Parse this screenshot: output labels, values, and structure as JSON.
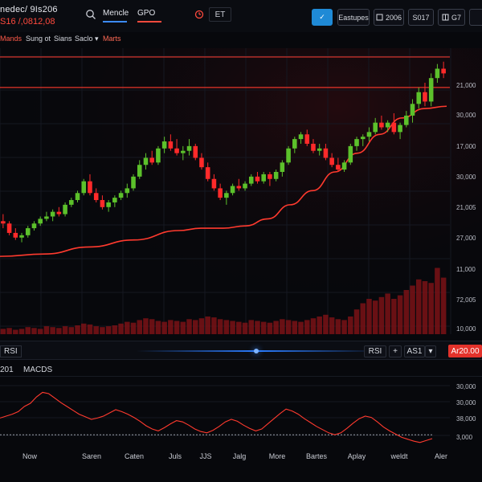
{
  "topbar": {
    "title": "nedec/ 9Is206",
    "price": "S16 /,0812,08",
    "tabs": [
      {
        "label": "Mencle",
        "accent": "#3c8bff"
      },
      {
        "label": "GPO",
        "accent": "#ff4a3d"
      }
    ],
    "et_label": "ET",
    "check_symbol": "✓",
    "buttons": [
      "Eastupes",
      "2006",
      "S017",
      "G7"
    ]
  },
  "menu": {
    "items": [
      {
        "label": "Mands",
        "color": "#ff5a4a"
      },
      {
        "label": "Sung ot",
        "color": "#d5d8df"
      },
      {
        "label": "Sians",
        "color": "#d5d8df"
      },
      {
        "label": "Saclo ▾",
        "color": "#d5d8df"
      },
      {
        "label": "Marts",
        "color": "#ff6a55"
      }
    ]
  },
  "main_axis": {
    "labels": [
      "21,000",
      "30,000",
      "17,000",
      "30,000",
      "21,005",
      "27,000",
      "11,000",
      "72,005",
      "10,000"
    ]
  },
  "chart_data": [
    {
      "type": "candlestick",
      "candles_ohlc": [
        [
          29,
          32,
          26,
          28
        ],
        [
          28,
          29,
          23,
          24
        ],
        [
          24,
          26,
          21,
          22
        ],
        [
          22,
          24,
          20,
          23
        ],
        [
          23,
          27,
          22,
          26
        ],
        [
          26,
          29,
          25,
          28
        ],
        [
          28,
          31,
          27,
          30
        ],
        [
          30,
          33,
          29,
          31
        ],
        [
          31,
          34,
          29,
          33
        ],
        [
          33,
          35,
          31,
          32
        ],
        [
          32,
          37,
          31,
          36
        ],
        [
          36,
          39,
          35,
          38
        ],
        [
          38,
          42,
          37,
          41
        ],
        [
          41,
          47,
          40,
          46
        ],
        [
          46,
          49,
          40,
          41
        ],
        [
          41,
          43,
          37,
          38
        ],
        [
          38,
          40,
          34,
          35
        ],
        [
          35,
          38,
          33,
          37
        ],
        [
          37,
          40,
          35,
          39
        ],
        [
          39,
          42,
          38,
          41
        ],
        [
          41,
          45,
          39,
          43
        ],
        [
          43,
          49,
          42,
          48
        ],
        [
          48,
          55,
          47,
          53
        ],
        [
          53,
          58,
          51,
          56
        ],
        [
          56,
          59,
          53,
          54
        ],
        [
          54,
          61,
          53,
          60
        ],
        [
          60,
          65,
          58,
          63
        ],
        [
          63,
          66,
          59,
          60
        ],
        [
          60,
          64,
          57,
          58
        ],
        [
          58,
          61,
          55,
          59
        ],
        [
          59,
          64,
          57,
          61
        ],
        [
          61,
          62,
          55,
          56
        ],
        [
          56,
          58,
          51,
          52
        ],
        [
          52,
          54,
          46,
          47
        ],
        [
          47,
          49,
          42,
          43
        ],
        [
          43,
          45,
          38,
          39
        ],
        [
          39,
          42,
          36,
          41
        ],
        [
          41,
          45,
          40,
          44
        ],
        [
          44,
          47,
          42,
          43
        ],
        [
          43,
          46,
          42,
          45
        ],
        [
          45,
          49,
          44,
          48
        ],
        [
          48,
          50,
          45,
          46
        ],
        [
          46,
          50,
          45,
          49
        ],
        [
          49,
          50,
          44,
          47
        ],
        [
          47,
          51,
          46,
          50
        ],
        [
          50,
          55,
          48,
          54
        ],
        [
          54,
          61,
          53,
          60
        ],
        [
          60,
          65,
          58,
          64
        ],
        [
          64,
          67,
          62,
          66
        ],
        [
          66,
          68,
          61,
          62
        ],
        [
          62,
          64,
          58,
          59
        ],
        [
          59,
          62,
          57,
          60
        ],
        [
          60,
          62,
          55,
          56
        ],
        [
          56,
          58,
          52,
          53
        ],
        [
          53,
          56,
          50,
          51
        ],
        [
          51,
          55,
          50,
          54
        ],
        [
          54,
          62,
          53,
          61
        ],
        [
          61,
          65,
          59,
          64
        ],
        [
          64,
          66,
          61,
          65
        ],
        [
          65,
          69,
          63,
          67
        ],
        [
          67,
          73,
          66,
          71
        ],
        [
          71,
          74,
          68,
          69
        ],
        [
          69,
          72,
          67,
          71
        ],
        [
          71,
          75,
          66,
          67
        ],
        [
          67,
          71,
          64,
          70
        ],
        [
          70,
          76,
          69,
          74
        ],
        [
          74,
          81,
          71,
          79
        ],
        [
          79,
          86,
          77,
          84
        ],
        [
          84,
          88,
          78,
          80
        ],
        [
          80,
          92,
          78,
          90
        ],
        [
          90,
          96,
          88,
          94
        ],
        [
          94,
          97,
          90,
          92
        ]
      ],
      "moving_average": [
        [
          0,
          14
        ],
        [
          10,
          15
        ],
        [
          20,
          18
        ],
        [
          30,
          21
        ],
        [
          40,
          25
        ],
        [
          45,
          26
        ],
        [
          50,
          26
        ],
        [
          55,
          27
        ],
        [
          60,
          30
        ],
        [
          65,
          36
        ],
        [
          70,
          42
        ],
        [
          75,
          50
        ],
        [
          80,
          58
        ],
        [
          85,
          66
        ],
        [
          90,
          73
        ],
        [
          95,
          77
        ],
        [
          100,
          78
        ]
      ],
      "volume": [
        6,
        7,
        5,
        6,
        8,
        7,
        6,
        9,
        8,
        7,
        9,
        8,
        10,
        12,
        11,
        9,
        8,
        9,
        10,
        12,
        14,
        13,
        16,
        18,
        17,
        15,
        14,
        16,
        15,
        14,
        17,
        16,
        18,
        20,
        19,
        17,
        16,
        15,
        14,
        13,
        16,
        15,
        14,
        13,
        15,
        17,
        16,
        15,
        14,
        16,
        18,
        20,
        22,
        19,
        17,
        16,
        20,
        28,
        35,
        40,
        38,
        42,
        46,
        40,
        44,
        50,
        55,
        62,
        60,
        58,
        75,
        64
      ],
      "horizontal_levels": [
        99,
        86
      ],
      "ylim": [
        0,
        100
      ]
    },
    {
      "type": "line",
      "series": [
        {
          "values": [
            42,
            45,
            48,
            52,
            60,
            65,
            75,
            82,
            80,
            73,
            66,
            60,
            54,
            48,
            44,
            40,
            42,
            45,
            50,
            55,
            52,
            48,
            43,
            37,
            30,
            25,
            22,
            27,
            33,
            38,
            36,
            31,
            25,
            21,
            19,
            23,
            29,
            36,
            40,
            37,
            31,
            26,
            22,
            25,
            33,
            41,
            49,
            56,
            53,
            48,
            41,
            35,
            29,
            24,
            19,
            16,
            19,
            26,
            34,
            41,
            45,
            43,
            36,
            28,
            22,
            17,
            12,
            9,
            6,
            4,
            7,
            10
          ]
        }
      ],
      "reference_line": 16,
      "ylim": [
        0,
        100
      ]
    }
  ],
  "separator": {
    "left_label": "RSI",
    "buttons": [
      "RSI",
      "+",
      "AS1",
      "▾"
    ],
    "alert_label": "Ar20.00"
  },
  "indicator": {
    "labels": [
      "201",
      "MACDS"
    ],
    "axis_labels": [
      "30,000",
      "30,000",
      "38,000",
      "3,000"
    ]
  },
  "xaxis": {
    "labels": [
      "Now",
      "Saren",
      "Caten",
      "Juls",
      "JJS",
      "Jalg",
      "More",
      "Bartes",
      "Aplay",
      "weldt",
      "Aler"
    ]
  },
  "colors": {
    "up": "#5cc12b",
    "down": "#ff2a2a",
    "line": "#ff3a2e",
    "volume": "#7a1216",
    "grid": "#151821",
    "accent": "#1f8ad6"
  }
}
